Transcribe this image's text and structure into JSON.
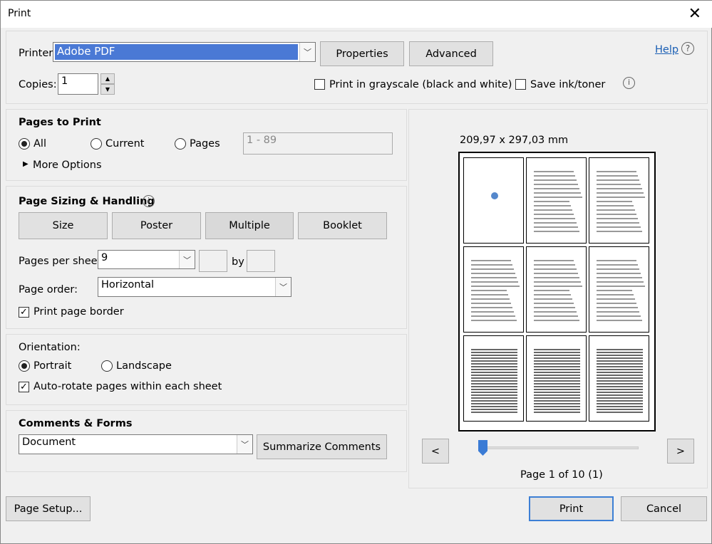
{
  "window": {
    "title": "Print",
    "close_icon": "close-icon"
  },
  "printer": {
    "label": "Printer:",
    "value": "Adobe PDF",
    "properties": "Properties",
    "advanced": "Advanced",
    "help": "Help"
  },
  "copies": {
    "label": "Copies:",
    "value": "1",
    "grayscale": "Print in grayscale (black and white)",
    "grayscale_checked": false,
    "save_ink": "Save ink/toner",
    "save_ink_checked": false
  },
  "pages_to_print": {
    "title": "Pages to Print",
    "all": "All",
    "current": "Current",
    "pages": "Pages",
    "range_placeholder": "1 - 89",
    "selected": "All",
    "more_options": "More Options"
  },
  "sizing": {
    "title": "Page Sizing & Handling",
    "tabs": [
      "Size",
      "Poster",
      "Multiple",
      "Booklet"
    ],
    "active_tab": "Multiple",
    "pages_per_sheet_label": "Pages per sheet:",
    "pages_per_sheet": "9",
    "by": "by",
    "page_order_label": "Page order:",
    "page_order": "Horizontal",
    "print_border": "Print page border",
    "print_border_checked": true
  },
  "orientation": {
    "title": "Orientation:",
    "portrait": "Portrait",
    "landscape": "Landscape",
    "selected": "Portrait",
    "auto_rotate": "Auto-rotate pages within each sheet",
    "auto_rotate_checked": true
  },
  "comments": {
    "title": "Comments & Forms",
    "value": "Document",
    "summarize": "Summarize Comments"
  },
  "preview": {
    "size": "209,97 x 297,03 mm",
    "prev": "<",
    "next": ">",
    "page_status": "Page 1 of 10 (1)",
    "slider_position": 0.0
  },
  "footer": {
    "page_setup": "Page Setup...",
    "print": "Print",
    "cancel": "Cancel"
  }
}
